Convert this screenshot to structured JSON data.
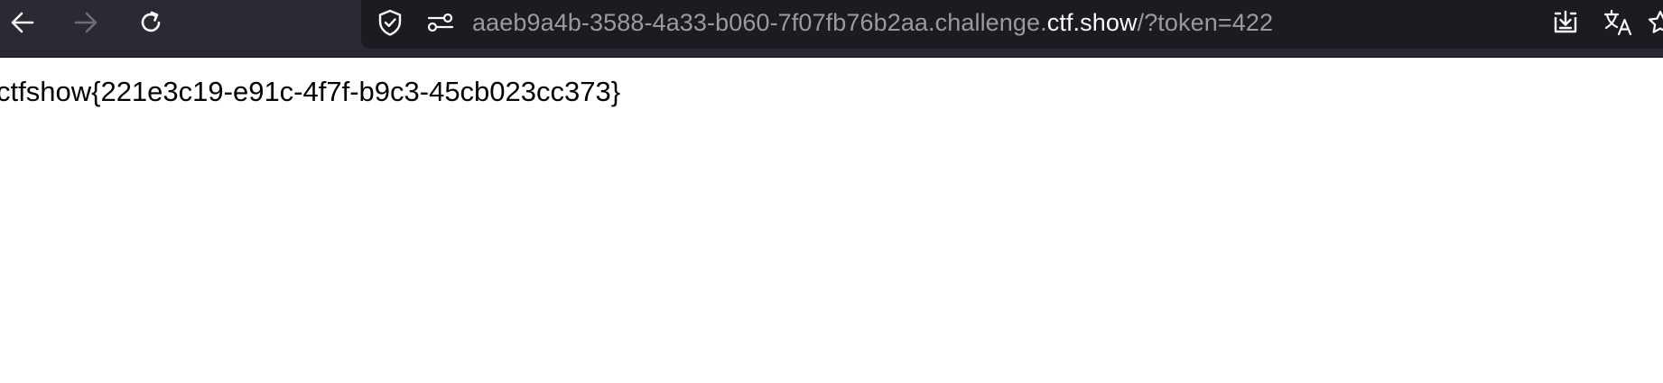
{
  "toolbar": {
    "url": {
      "subdomain": "aaeb9a4b-3588-4a33-b060-7f07fb76b2aa.challenge.",
      "host": "ctf.show",
      "path": "/?token=422"
    },
    "icons": {
      "back": "back-arrow-icon",
      "forward": "forward-arrow-icon",
      "reload": "reload-icon",
      "shield": "tracking-protection-shield-icon",
      "permissions": "site-permissions-icon",
      "download": "download-icon",
      "translate": "translate-icon",
      "bookmark": "bookmark-star-icon"
    },
    "colors": {
      "toolbar_bg": "#2b2a33",
      "urlbar_bg": "#1c1b22",
      "url_dim": "#9b9aa2",
      "url_host": "#fbfbfe",
      "disabled_icon": "#6e6d76"
    }
  },
  "page": {
    "body_text": "ctfshow{221e3c19-e91c-4f7f-b9c3-45cb023cc373}"
  }
}
